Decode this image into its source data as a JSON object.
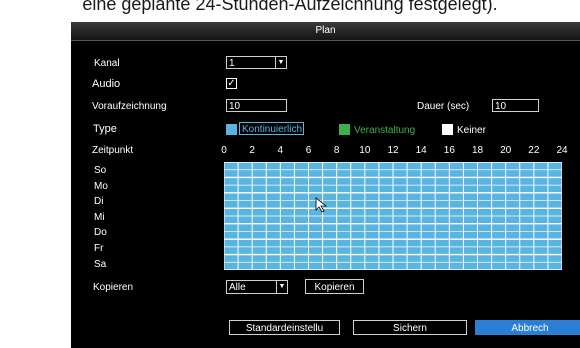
{
  "caption": "eine geplante 24-Stunden-Aufzeichnung festgelegt).",
  "window": {
    "title": "Plan"
  },
  "form": {
    "kanal_label": "Kanal",
    "kanal_value": "1",
    "audio_label": "Audio",
    "audio_checked": true,
    "vorauf_label": "Voraufzeichnung",
    "vorauf_value": "10",
    "dauer_label": "Dauer (sec)",
    "dauer_value": "10",
    "type_label": "Type",
    "type_options": [
      {
        "label": "Kontinuierlich",
        "color": "#5ab4e0",
        "selected": true
      },
      {
        "label": "Veranstaltung",
        "color": "#3cb04a"
      },
      {
        "label": "Keiner",
        "color": "#ffffff"
      }
    ],
    "zeitpunkt_label": "Zeitpunkt"
  },
  "schedule": {
    "hours": [
      "0",
      "2",
      "4",
      "6",
      "8",
      "10",
      "12",
      "14",
      "16",
      "18",
      "20",
      "22",
      "24"
    ],
    "days": [
      "So",
      "Mo",
      "Di",
      "Mi",
      "Do",
      "Fr",
      "Sa"
    ],
    "slot_color": "#5ab4e0"
  },
  "kopieren": {
    "label": "Kopieren",
    "select_value": "Alle",
    "button_label": "Kopieren"
  },
  "footer": {
    "default_label": "Standardeinstellu",
    "save_label": "Sichern",
    "cancel_label": "Abbrech"
  }
}
